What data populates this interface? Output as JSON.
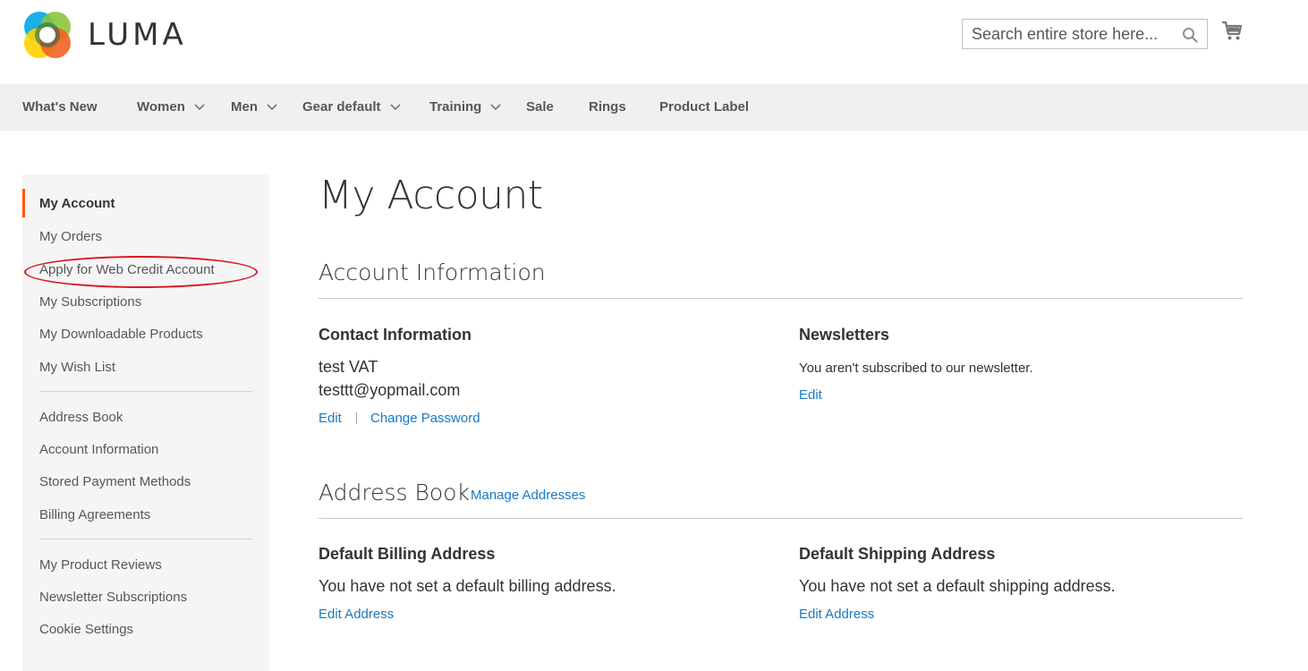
{
  "header": {
    "logo_text": "LUMA",
    "search": {
      "placeholder": "Search entire store here..."
    },
    "icons": {
      "search": "search-icon",
      "cart": "cart-icon"
    },
    "logo_colors": [
      "#f26322",
      "#00a6e4",
      "#8bc53f",
      "#ffd200",
      "#1a5e5a"
    ]
  },
  "nav": {
    "items": [
      {
        "label": "What's New"
      },
      {
        "label": "Women"
      },
      {
        "label": "Men"
      },
      {
        "label": "Gear default"
      },
      {
        "label": "Training"
      },
      {
        "label": "Sale"
      },
      {
        "label": "Rings"
      },
      {
        "label": "Product Label"
      }
    ]
  },
  "sidebar": {
    "items": [
      {
        "label": "My Account"
      },
      {
        "label": "My Orders"
      },
      {
        "label": "Apply for Web Credit Account"
      },
      {
        "label": "My Subscriptions"
      },
      {
        "label": "My Downloadable Products"
      },
      {
        "label": "My Wish List"
      },
      {
        "label": "Address Book"
      },
      {
        "label": "Account Information"
      },
      {
        "label": "Stored Payment Methods"
      },
      {
        "label": "Billing Agreements"
      },
      {
        "label": "My Product Reviews"
      },
      {
        "label": "Newsletter Subscriptions"
      },
      {
        "label": "Cookie Settings"
      }
    ],
    "active_color": "#ff5501",
    "highlight_color": "#d9151e"
  },
  "main": {
    "title": "My Account",
    "account_info": {
      "title": "Account Information",
      "contact": {
        "title": "Contact Information",
        "name": "test VAT",
        "email": "testtt@yopmail.com",
        "edit_label": "Edit",
        "change_password_label": "Change Password"
      },
      "newsletters": {
        "title": "Newsletters",
        "text": "You aren't subscribed to our newsletter.",
        "edit_label": "Edit"
      }
    },
    "address_book": {
      "title": "Address Book",
      "manage_label": "Manage Addresses",
      "billing": {
        "title": "Default Billing Address",
        "text": "You have not set a default billing address.",
        "edit_label": "Edit Address"
      },
      "shipping": {
        "title": "Default Shipping Address",
        "text": "You have not set a default shipping address.",
        "edit_label": "Edit Address"
      }
    }
  },
  "link_color": "#1979c3"
}
